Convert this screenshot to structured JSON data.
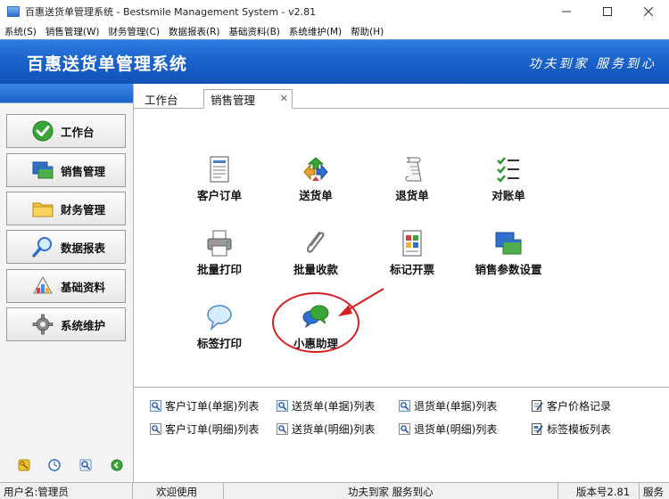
{
  "window": {
    "title": "百惠送货单管理系统 - Bestsmile Management System - v2.81",
    "controls": [
      "minimize",
      "maximize",
      "close"
    ]
  },
  "menu": [
    "系统(S)",
    "销售管理(W)",
    "财务管理(C)",
    "数据报表(R)",
    "基础资料(B)",
    "系统维护(M)",
    "帮助(H)"
  ],
  "banner": {
    "title": "百惠送货单管理系统",
    "slogan": "功夫到家 服务到心"
  },
  "sidebar": {
    "items": [
      {
        "label": "工作台",
        "icon": "green-check-icon"
      },
      {
        "label": "销售管理",
        "icon": "windows-icon"
      },
      {
        "label": "财务管理",
        "icon": "folder-icon"
      },
      {
        "label": "数据报表",
        "icon": "magnifier-icon"
      },
      {
        "label": "基础资料",
        "icon": "palette-icon"
      },
      {
        "label": "系统维护",
        "icon": "gear-icon"
      }
    ],
    "tools": [
      "key-icon",
      "clock-icon",
      "search-icon",
      "exit-icon"
    ]
  },
  "tabs": [
    {
      "label": "工作台",
      "active": false
    },
    {
      "label": "销售管理",
      "active": true
    }
  ],
  "functions": [
    {
      "label": "客户订单",
      "icon": "document-form-icon"
    },
    {
      "label": "送货单",
      "icon": "recycle-arrows-icon"
    },
    {
      "label": "退货单",
      "icon": "scroll-icon"
    },
    {
      "label": "对账单",
      "icon": "checklist-icon"
    },
    {
      "label": "批量打印",
      "icon": "printer-icon"
    },
    {
      "label": "批量收款",
      "icon": "paperclip-icon"
    },
    {
      "label": "标记开票",
      "icon": "invoice-icon"
    },
    {
      "label": "销售参数设置",
      "icon": "windows-icon"
    },
    {
      "label": "标签打印",
      "icon": "speech-bubble-icon"
    },
    {
      "label": "小惠助理",
      "icon": "chat-bubbles-icon"
    }
  ],
  "links": [
    {
      "label": "客户订单(单据)列表",
      "icon": "list-search-icon"
    },
    {
      "label": "送货单(单据)列表",
      "icon": "list-search-icon"
    },
    {
      "label": "退货单(单据)列表",
      "icon": "list-search-icon"
    },
    {
      "label": "客户价格记录",
      "icon": "price-edit-icon"
    },
    {
      "label": "客户订单(明细)列表",
      "icon": "detail-search-icon"
    },
    {
      "label": "送货单(明细)列表",
      "icon": "detail-search-icon"
    },
    {
      "label": "退货单(明细)列表",
      "icon": "detail-search-icon"
    },
    {
      "label": "标签模板列表",
      "icon": "template-edit-icon"
    }
  ],
  "status": {
    "user": "用户名:管理员",
    "welcome": "欢迎使用",
    "slogan": "功夫到家 服务到心",
    "version": "版本号2.81",
    "service": "服务"
  },
  "colors": {
    "banner": "#1b63cc",
    "highlight": "#d42020"
  }
}
